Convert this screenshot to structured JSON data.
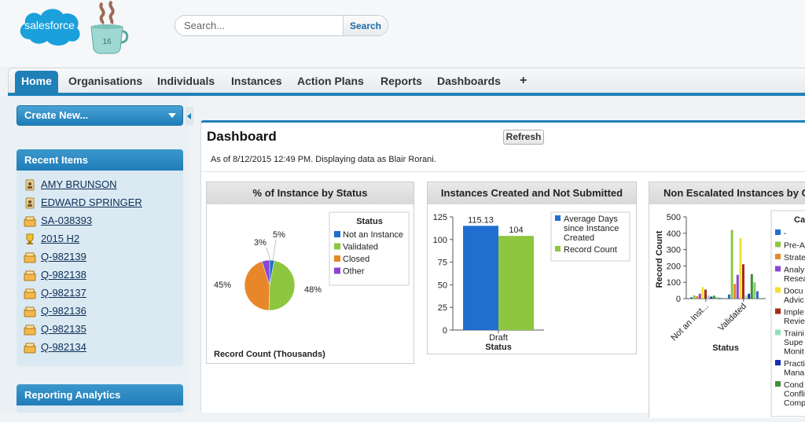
{
  "header": {
    "logo_text": "salesforce",
    "mug_badge": "16",
    "search": {
      "placeholder": "Search...",
      "button_label": "Search"
    }
  },
  "tabs": [
    {
      "label": "Home",
      "active": true
    },
    {
      "label": "Organisations"
    },
    {
      "label": "Individuals"
    },
    {
      "label": "Instances"
    },
    {
      "label": "Action Plans"
    },
    {
      "label": "Reports"
    },
    {
      "label": "Dashboards"
    },
    {
      "label": "+"
    }
  ],
  "sidebar": {
    "create_new": "Create New...",
    "recent_items_title": "Recent Items",
    "recent_items": [
      {
        "label": "AMY BRUNSON",
        "icon": "contact-icon"
      },
      {
        "label": "EDWARD SPRINGER",
        "icon": "contact-icon"
      },
      {
        "label": "SA-038393",
        "icon": "record-icon"
      },
      {
        "label": "2015 H2",
        "icon": "trophy-icon"
      },
      {
        "label": "Q-982139",
        "icon": "record-icon"
      },
      {
        "label": "Q-982138",
        "icon": "record-icon"
      },
      {
        "label": "Q-982137",
        "icon": "record-icon"
      },
      {
        "label": "Q-982136",
        "icon": "record-icon"
      },
      {
        "label": "Q-982135",
        "icon": "record-icon"
      },
      {
        "label": "Q-982134",
        "icon": "record-icon"
      }
    ],
    "reporting_title": "Reporting Analytics"
  },
  "dashboard": {
    "title": "Dashboard",
    "refresh_label": "Refresh",
    "as_of": "As of 8/12/2015 12:49 PM. Displaying data as Blair Rorani."
  },
  "colors": {
    "blue": "#1f6fd0",
    "green": "#8dc63f",
    "orange": "#e8872a",
    "purple": "#8e44d6",
    "yellow": "#f2e22b",
    "darkred": "#a82b1a",
    "mint": "#8fe0b8",
    "navy": "#1a2fb0",
    "darkgreen": "#3f8f3a"
  },
  "chart_data": [
    {
      "type": "pie",
      "title": "% of Instance by Status",
      "legend_title": "Status",
      "footer": "Record Count (Thousands)",
      "slices": [
        {
          "name": "Not an Instance",
          "value": 3,
          "label": "3%",
          "color": "#1f6fd0"
        },
        {
          "name": "Validated",
          "value": 48,
          "label": "48%",
          "color": "#8dc63f"
        },
        {
          "name": "Closed",
          "value": 45,
          "label": "45%",
          "color": "#e8872a"
        },
        {
          "name": "Other",
          "value": 5,
          "label": "5%",
          "color": "#8e44d6"
        }
      ]
    },
    {
      "type": "bar",
      "title": "Instances Created and Not Submitted",
      "categories": [
        "Draft"
      ],
      "xlabel": "Status",
      "ylim": [
        0,
        125
      ],
      "yticks": [
        0,
        25,
        50,
        75,
        100,
        125
      ],
      "series": [
        {
          "name": "Average Days since Instance Created",
          "values": [
            115.13
          ],
          "label": "115.13",
          "color": "#1f6fd0"
        },
        {
          "name": "Record Count",
          "values": [
            104
          ],
          "label": "104",
          "color": "#8dc63f"
        }
      ],
      "legend_lines": [
        [
          "Average Days",
          "since Instance",
          "Created"
        ],
        [
          "Record Count"
        ]
      ]
    },
    {
      "type": "bar",
      "title": "Non Escalated Instances by C",
      "categories": [
        "Not an Inst...",
        "Validated"
      ],
      "xlabel": "Status",
      "ylabel": "Record Count",
      "ylim": [
        0,
        500
      ],
      "yticks": [
        0,
        100,
        200,
        300,
        400,
        500
      ],
      "legend_title": "Cat",
      "series": [
        {
          "name": "-",
          "values": [
            8,
            25
          ],
          "color": "#1f6fd0"
        },
        {
          "name": "Pre-A",
          "values": [
            20,
            420
          ],
          "color": "#8dc63f"
        },
        {
          "name": "Strate",
          "values": [
            15,
            90
          ],
          "color": "#e8872a"
        },
        {
          "name": "Analy Resea",
          "values": [
            30,
            145
          ],
          "color": "#8e44d6"
        },
        {
          "name": "Docu Advic",
          "values": [
            70,
            370
          ],
          "color": "#f2e22b"
        },
        {
          "name": "Imple Revie",
          "values": [
            55,
            210
          ],
          "color": "#a82b1a"
        },
        {
          "name": "Traini Supe Monit",
          "values": [
            20,
            20
          ],
          "color": "#8fe0b8"
        },
        {
          "name": "Practi Mana",
          "values": [
            12,
            30
          ],
          "color": "#1a2fb0"
        },
        {
          "name": "Cond Confli Comp",
          "values": [
            18,
            150
          ],
          "color": "#3f8f3a"
        },
        {
          "name": "",
          "values": [
            10,
            100
          ],
          "color": "#7fd36b"
        },
        {
          "name": "",
          "values": [
            5,
            45
          ],
          "color": "#3a66c8"
        }
      ],
      "legend_lines": [
        [
          "-"
        ],
        [
          "Pre-A"
        ],
        [
          "Strate"
        ],
        [
          "Analy",
          "Resea"
        ],
        [
          "Docu",
          "Advic"
        ],
        [
          "Imple",
          "Revie"
        ],
        [
          "Traini",
          "Supe",
          "Monit"
        ],
        [
          "Practi",
          "Mana"
        ],
        [
          "Cond",
          "Confli",
          "Comp"
        ]
      ]
    }
  ]
}
